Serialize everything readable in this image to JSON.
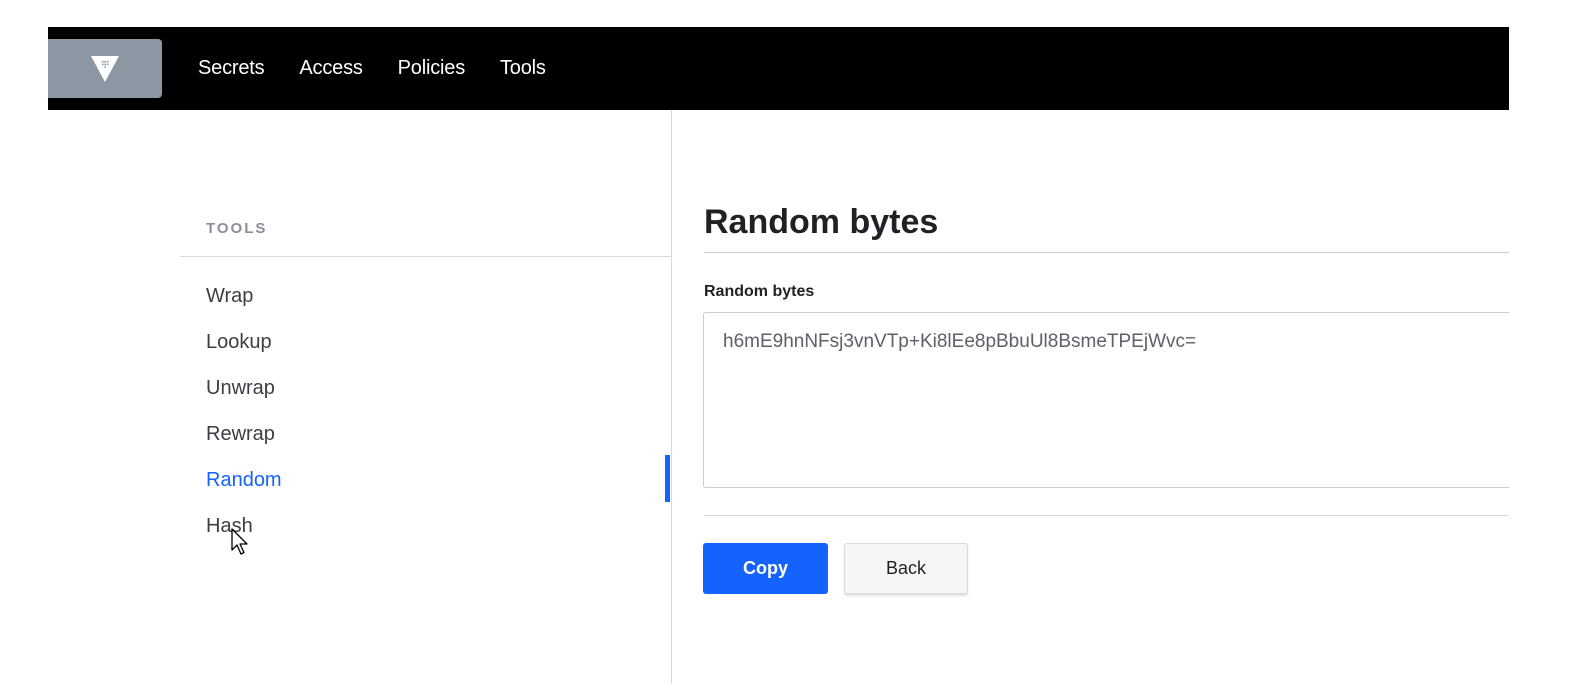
{
  "nav": {
    "items": [
      "Secrets",
      "Access",
      "Policies",
      "Tools"
    ]
  },
  "sidebar": {
    "heading": "TOOLS",
    "items": [
      {
        "label": "Wrap"
      },
      {
        "label": "Lookup"
      },
      {
        "label": "Unwrap"
      },
      {
        "label": "Rewrap"
      },
      {
        "label": "Random",
        "active": true
      },
      {
        "label": "Hash"
      }
    ]
  },
  "main": {
    "title": "Random bytes",
    "field_label": "Random bytes",
    "output_value": "h6mE9hnNFsj3vnVTp+Ki8lEe8pBbuUl8BsmeTPEjWvc=",
    "copy_label": "Copy",
    "back_label": "Back"
  },
  "colors": {
    "topbar": "#000000",
    "accent": "#1563ff",
    "logo_bg": "#8d97a4"
  },
  "icons": {
    "logo": "vault-logo-icon",
    "cursor": "mouse-pointer-icon"
  }
}
